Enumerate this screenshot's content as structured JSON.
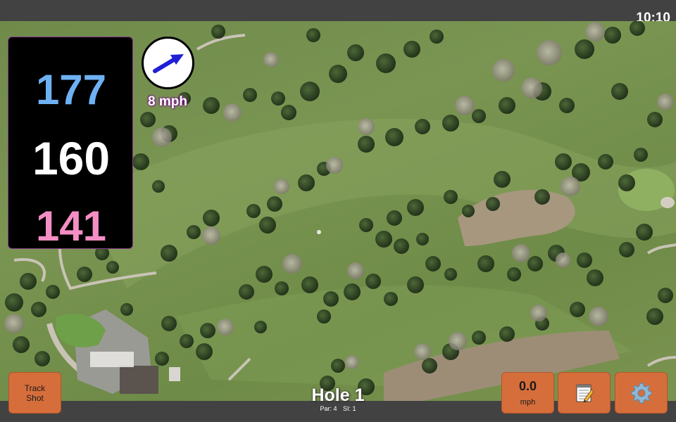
{
  "status_bar": {
    "time": "10:10"
  },
  "distances": {
    "back": "177",
    "middle": "160",
    "front": "141"
  },
  "wind": {
    "speed_label": "8 mph",
    "direction_icon": "arrow-icon"
  },
  "buttons": {
    "track_shot_line1": "Track",
    "track_shot_line2": "Shot",
    "speed_value": "0.0",
    "speed_unit": "mph",
    "notes_icon": "notepad-icon",
    "settings_icon": "gear-icon"
  },
  "hole": {
    "title": "Hole 1",
    "par": "Par: 4",
    "si": "SI: 1"
  },
  "colors": {
    "back_distance": "#6db1f3",
    "middle_distance": "#ffffff",
    "front_distance": "#f48ec4",
    "button": "#d66e3c",
    "panel": "#000000"
  }
}
